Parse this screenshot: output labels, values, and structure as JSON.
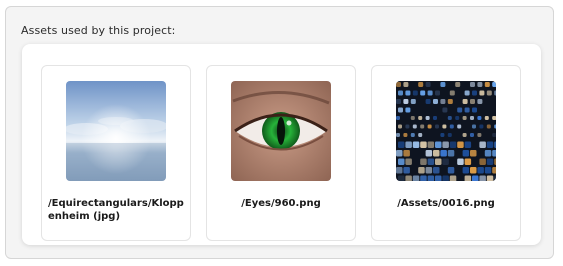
{
  "panel": {
    "title": "Assets used by this project:"
  },
  "assets": [
    {
      "path": "/Equirectangulars/Kloppenheim (jpg)",
      "thumbnail_icon": "sky-panorama-thumbnail"
    },
    {
      "path": "/Eyes/960.png",
      "thumbnail_icon": "eye-thumbnail"
    },
    {
      "path": "/Assets/0016.png",
      "thumbnail_icon": "blue-tiles-thumbnail"
    }
  ],
  "colors": {
    "panel_background": "#f4f4f4",
    "card_border": "#e4e4e4",
    "text": "#1a1a1a"
  }
}
